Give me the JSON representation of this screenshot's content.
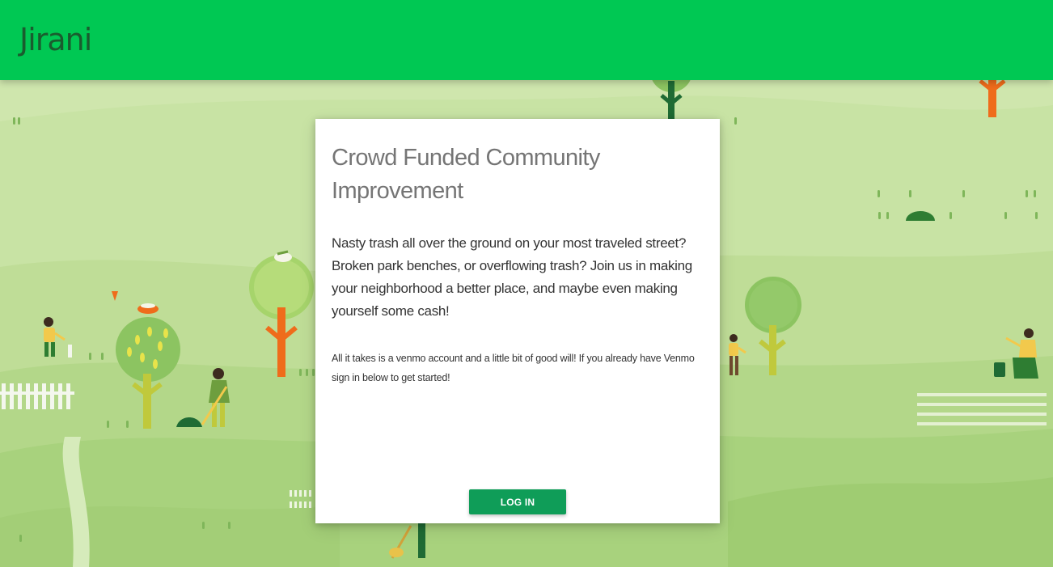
{
  "header": {
    "title": "Jirani",
    "color": "#00c853"
  },
  "card": {
    "title": "Crowd Funded Community Improvement",
    "lead": "Nasty trash all over the ground on your most traveled street? Broken park benches, or overflowing trash? Join us in making your neighborhood a better place, and maybe even making yourself some cash!",
    "note": "All it takes is a venmo account and a little bit of good will! If you already have Venmo sign in below to get started!",
    "login_label": "LOG IN",
    "button_color": "#0f9d58"
  }
}
